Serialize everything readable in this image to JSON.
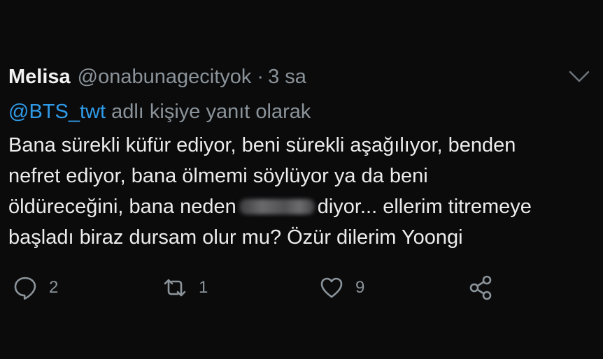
{
  "tweet": {
    "display_name": "Melisa",
    "handle": "@onabunagecityok",
    "separator": "·",
    "time": "3 sa",
    "reply_to_handle": "@BTS_twt",
    "reply_to_text": "adlı kişiye yanıt olarak",
    "body": {
      "line1": "Bana sürekli küfür ediyor, beni sürekli aşağılıyor, benden",
      "line2": "nefret ediyor, bana ölmemi söylüyor ya da beni",
      "line3_before": "öldüreceğini, bana neden",
      "line3_after": "diyor... ellerim titremeye",
      "line4": "başladı biraz dursam olur mu? Özür dilerim Yoongi"
    },
    "reply_count": "2",
    "retweet_count": "1",
    "like_count": "9"
  },
  "icons": {
    "menu": "chevron-down-icon",
    "reply": "comment-icon",
    "retweet": "retweet-icon",
    "like": "heart-icon",
    "share": "share-icon"
  },
  "colors": {
    "background": "#0b0b0c",
    "mention": "#2f9be8",
    "muted": "#8b949a",
    "text": "#ececec"
  }
}
